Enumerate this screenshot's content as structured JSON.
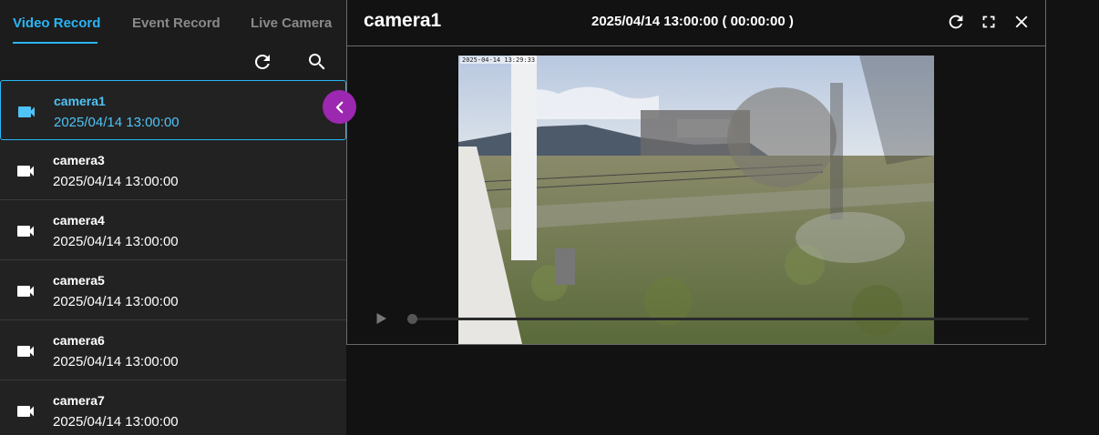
{
  "tabs": [
    {
      "label": "Video Record",
      "active": true
    },
    {
      "label": "Event Record",
      "active": false
    },
    {
      "label": "Live Camera",
      "active": false
    }
  ],
  "toolbar": {
    "refresh_icon": "refresh-icon",
    "search_icon": "search-icon"
  },
  "cameras": [
    {
      "name": "camera1",
      "time": "2025/04/14 13:00:00",
      "active": true
    },
    {
      "name": "camera3",
      "time": "2025/04/14 13:00:00",
      "active": false
    },
    {
      "name": "camera4",
      "time": "2025/04/14 13:00:00",
      "active": false
    },
    {
      "name": "camera5",
      "time": "2025/04/14 13:00:00",
      "active": false
    },
    {
      "name": "camera6",
      "time": "2025/04/14 13:00:00",
      "active": false
    },
    {
      "name": "camera7",
      "time": "2025/04/14 13:00:00",
      "active": false
    }
  ],
  "viewer": {
    "title": "camera1",
    "timestamp": "2025/04/14 13:00:00 ( 00:00:00 )",
    "osd_text": "2025-04-14 13:29:33",
    "playback_progress": 0.0
  },
  "colors": {
    "accent": "#29b6f6",
    "collapse_button": "#9c27b0",
    "panel_bg": "#1c1c1c",
    "page_bg": "#121212"
  }
}
